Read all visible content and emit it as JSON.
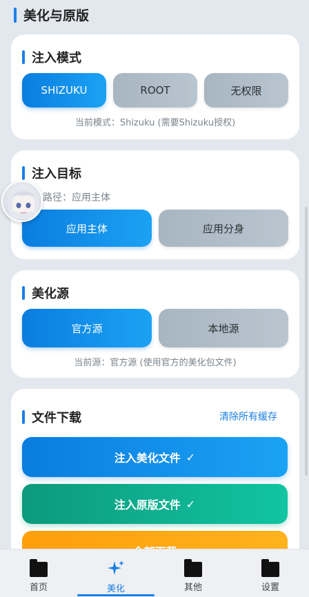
{
  "header": {
    "title": "美化与原版"
  },
  "inject_mode": {
    "title": "注入模式",
    "options": [
      "SHIZUKU",
      "ROOT",
      "无权限"
    ],
    "selected": "SHIZUKU",
    "hint": "当前模式：Shizuku (需要Shizuku授权)"
  },
  "inject_target": {
    "title": "注入目标",
    "path_label": "路径：应用主体",
    "options": [
      "应用主体",
      "应用分身"
    ],
    "selected": "应用主体"
  },
  "beautify_source": {
    "title": "美化源",
    "options": [
      "官方源",
      "本地源"
    ],
    "selected": "官方源",
    "hint": "当前源：官方源 (使用官方的美化包文件)"
  },
  "file_download": {
    "title": "文件下载",
    "clear_cache": "清除所有缓存",
    "inject_beautify": "注入美化文件",
    "inject_original": "注入原版文件",
    "download_all": "全部下载",
    "check_mark": "✓"
  },
  "bottom_nav": {
    "items": [
      {
        "label": "首页",
        "icon": "folder-icon"
      },
      {
        "label": "美化",
        "icon": "sparkle-icon"
      },
      {
        "label": "其他",
        "icon": "folder-icon"
      },
      {
        "label": "设置",
        "icon": "folder-icon"
      }
    ],
    "active": "美化"
  },
  "colors": {
    "accent": "#1a7fe6",
    "green": "#11c4a2",
    "orange": "#ffa514",
    "inactive": "#b0bdc8"
  }
}
